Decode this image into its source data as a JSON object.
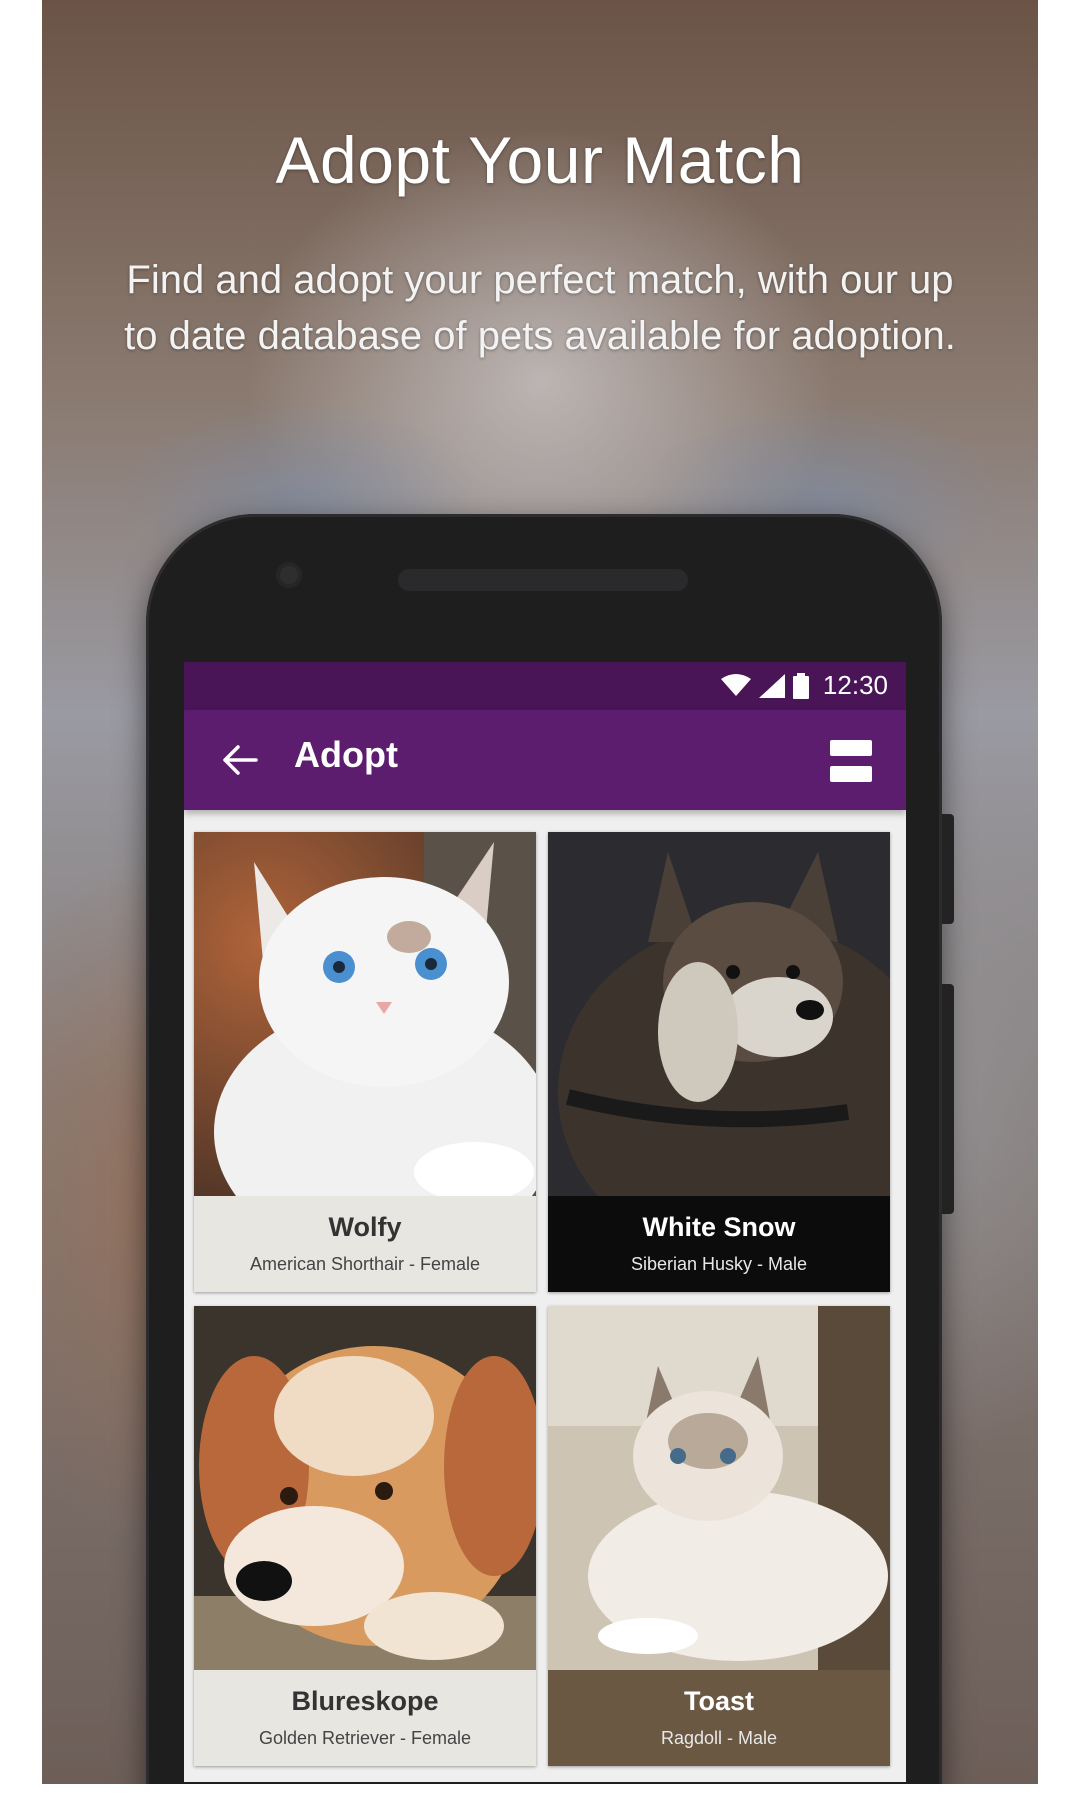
{
  "promo": {
    "title": "Adopt Your Match",
    "subtitle": "Find and adopt your perfect match, with our up to date database of pets available for adoption."
  },
  "status_bar": {
    "time": "12:30",
    "icons": [
      "wifi-icon",
      "signal-icon",
      "battery-icon"
    ]
  },
  "app_bar": {
    "title": "Adopt",
    "back_icon": "arrow-left-icon",
    "toggle_icon": "view-list-icon"
  },
  "theme": {
    "status_bar_color": "#4a1557",
    "app_bar_color": "#5d1d6f"
  },
  "pets": [
    {
      "name": "Wolfy",
      "breed": "American Shorthair - Female",
      "photo": "white kitten"
    },
    {
      "name": "White Snow",
      "breed": "Siberian Husky - Male",
      "photo": "husky dog"
    },
    {
      "name": "Blureskope",
      "breed": "Golden Retriever - Female",
      "photo": "golden retriever puppy"
    },
    {
      "name": "Toast",
      "breed": "Ragdoll - Male",
      "photo": "ragdoll cat"
    }
  ]
}
